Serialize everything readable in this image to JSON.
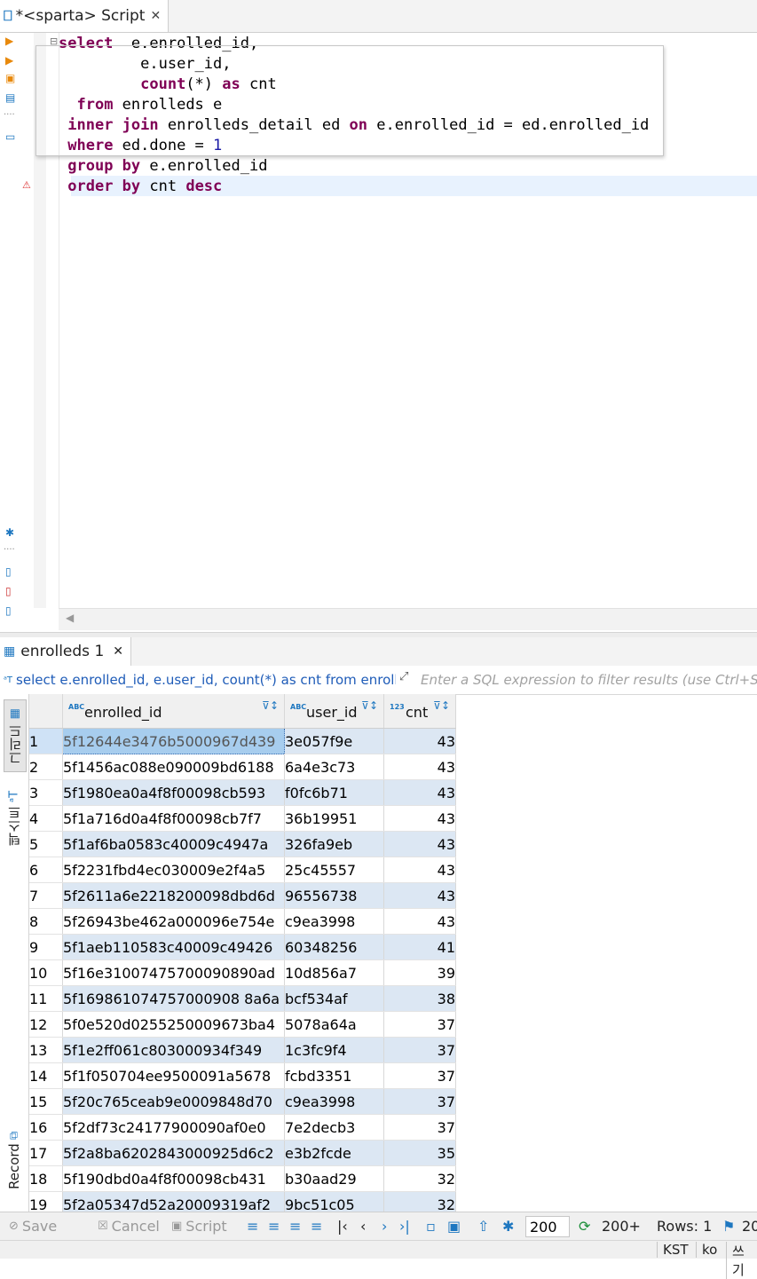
{
  "editor_tab": {
    "title": "*<sparta> Script",
    "close": "✕"
  },
  "sql_lines": [
    {
      "indent": "",
      "parts": [
        {
          "t": "select",
          "k": true
        },
        {
          "t": "  e.enrolled_id,"
        }
      ]
    },
    {
      "indent": "         ",
      "parts": [
        {
          "t": "e.user_id,"
        }
      ]
    },
    {
      "indent": "         ",
      "parts": [
        {
          "t": "count",
          "k": true
        },
        {
          "t": "(*) "
        },
        {
          "t": "as",
          "k": true
        },
        {
          "t": " cnt"
        }
      ]
    },
    {
      "indent": "  ",
      "parts": [
        {
          "t": "from",
          "k": true
        },
        {
          "t": " enrolleds e"
        }
      ]
    },
    {
      "indent": " ",
      "parts": [
        {
          "t": "inner join",
          "k": true
        },
        {
          "t": " enrolleds_detail ed "
        },
        {
          "t": "on",
          "k": true
        },
        {
          "t": " e.enrolled_id = ed.enrolled_id"
        }
      ]
    },
    {
      "indent": " ",
      "parts": [
        {
          "t": "where",
          "k": true
        },
        {
          "t": " ed.done = "
        },
        {
          "t": "1",
          "n": true
        }
      ]
    },
    {
      "indent": " ",
      "parts": [
        {
          "t": "group by",
          "k": true
        },
        {
          "t": " e.enrolled_id"
        }
      ]
    },
    {
      "indent": " ",
      "parts": [
        {
          "t": "order by",
          "k": true
        },
        {
          "t": " cnt "
        },
        {
          "t": "desc",
          "k": true
        }
      ]
    }
  ],
  "results_tab": {
    "title": "enrolleds 1",
    "close": "✕"
  },
  "filter": {
    "query": "select e.enrolled_id, e.user_id, count(*) as cnt from enrolleds e",
    "placeholder": "Enter a SQL expression to filter results (use Ctrl+Space)"
  },
  "side_tabs": {
    "grid": "그리드",
    "text": "텍스트",
    "record": "Record"
  },
  "columns": [
    {
      "type": "ABC",
      "name": "enrolled_id"
    },
    {
      "type": "ABC",
      "name": "user_id"
    },
    {
      "type": "123",
      "name": "cnt"
    }
  ],
  "rows": [
    [
      "1",
      "5f12644e3476b5000967d439",
      "3e057f9e",
      "43"
    ],
    [
      "2",
      "5f1456ac088e090009bd6188",
      "6a4e3c73",
      "43"
    ],
    [
      "3",
      "5f1980ea0a4f8f00098cb593",
      "f0fc6b71",
      "43"
    ],
    [
      "4",
      "5f1a716d0a4f8f00098cb7f7",
      "36b19951",
      "43"
    ],
    [
      "5",
      "5f1af6ba0583c40009c4947a",
      "326fa9eb",
      "43"
    ],
    [
      "6",
      "5f2231fbd4ec030009e2f4a5",
      "25c45557",
      "43"
    ],
    [
      "7",
      "5f2611a6e2218200098dbd6d",
      "96556738",
      "43"
    ],
    [
      "8",
      "5f26943be462a000096e754e",
      "c9ea3998",
      "43"
    ],
    [
      "9",
      "5f1aeb110583c40009c49426",
      "60348256",
      "41"
    ],
    [
      "10",
      "5f16e31007475700090890ad",
      "10d856a7",
      "39"
    ],
    [
      "11",
      "5f169861074757000908 8a6a",
      "bcf534af",
      "38"
    ],
    [
      "12",
      "5f0e520d0255250009673ba4",
      "5078a64a",
      "37"
    ],
    [
      "13",
      "5f1e2ff061c803000934f349",
      "1c3fc9f4",
      "37"
    ],
    [
      "14",
      "5f1f050704ee9500091a5678",
      "fcbd3351",
      "37"
    ],
    [
      "15",
      "5f20c765ceab9e0009848d70",
      "c9ea3998",
      "37"
    ],
    [
      "16",
      "5f2df73c24177900090af0e0",
      "7e2decb3",
      "37"
    ],
    [
      "17",
      "5f2a8ba6202843000925d6c2",
      "e3b2fcde",
      "35"
    ],
    [
      "18",
      "5f190dbd0a4f8f00098cb431",
      "b30aad29",
      "32"
    ],
    [
      "19",
      "5f2a05347d52a20009319af2",
      "9bc51c05",
      "32"
    ]
  ],
  "bottom_toolbar": {
    "save": "Save",
    "cancel": "Cancel",
    "script": "Script",
    "fetch_size": "200",
    "fetch_more": "200+",
    "rows": "Rows: 1",
    "extra": "20"
  },
  "status_bar": {
    "timezone": "KST",
    "locale": "ko",
    "mode": "쓰기"
  }
}
